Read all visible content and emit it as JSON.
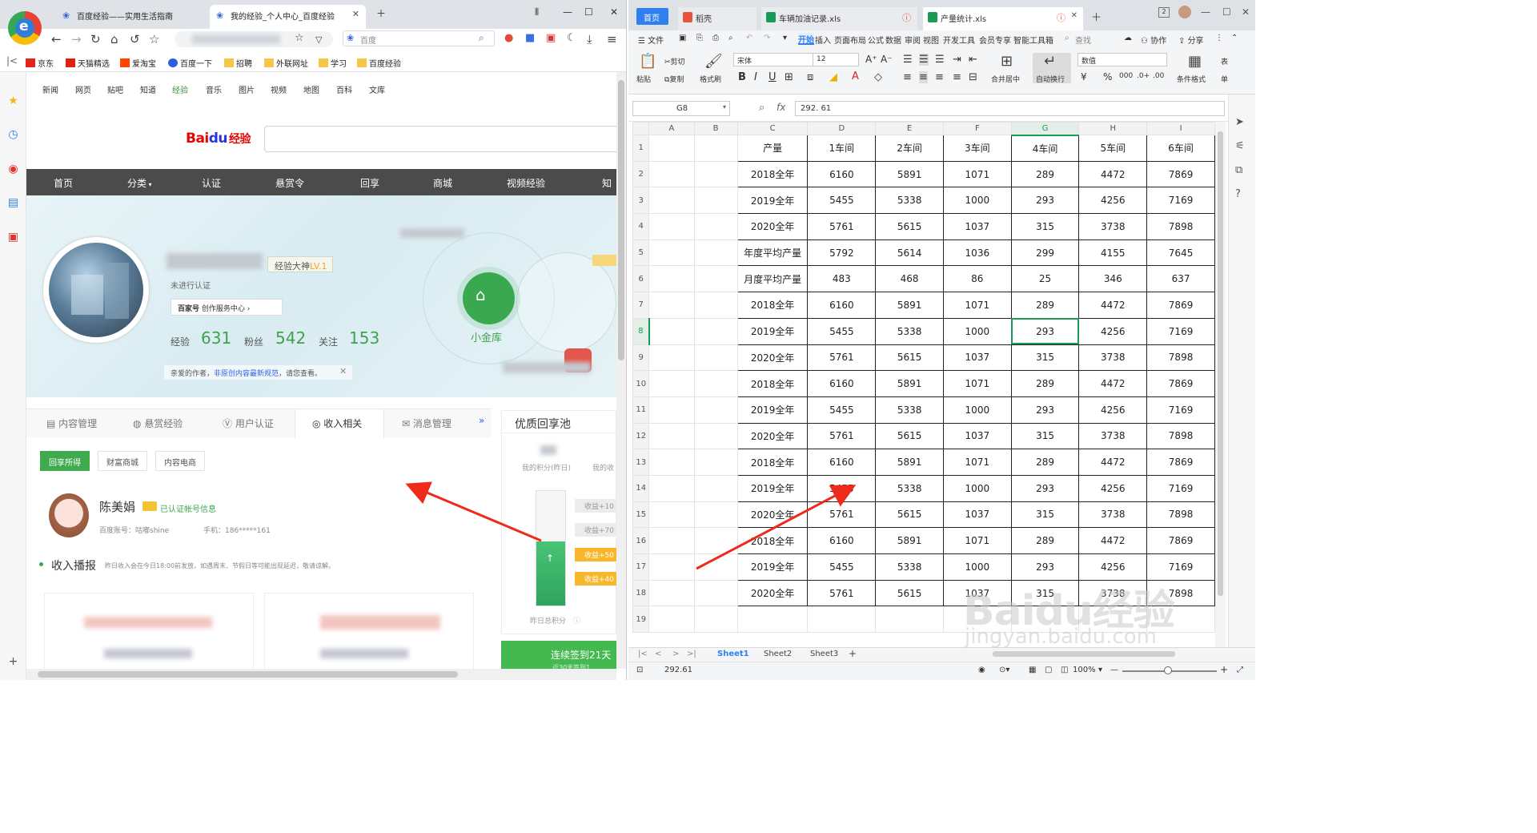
{
  "browser": {
    "tabs": [
      {
        "title": "百度经验——实用生活指南"
      },
      {
        "title": "我的经验_个人中心_百度经验"
      }
    ],
    "search_engine": "百度",
    "bookmarks": [
      "京东",
      "天猫精选",
      "爱淘宝",
      "百度一下",
      "招聘",
      "外联网址",
      "学习",
      "百度经验"
    ],
    "colors": {
      "accent_green": "#3fab4e",
      "menu_bg": "#4b4b4b"
    }
  },
  "page": {
    "top_nav": [
      "新闻",
      "网页",
      "贴吧",
      "知道",
      "经验",
      "音乐",
      "图片",
      "视频",
      "地图",
      "百科",
      "文库"
    ],
    "logo": {
      "bai": "Bai",
      "du": "du",
      "jy": "经验"
    },
    "main_menu": [
      "首页",
      "分类",
      "认证",
      "悬赏令",
      "回享",
      "商城",
      "视频经验",
      "知"
    ],
    "profile": {
      "level_label": "经验大神",
      "level": "LV.1",
      "cert_status": "未进行认证",
      "bjh_label": "百家号",
      "bjh_link": "创作服务中心",
      "stats": [
        {
          "label": "经验",
          "value": "631"
        },
        {
          "label": "粉丝",
          "value": "542"
        },
        {
          "label": "关注",
          "value": "153"
        }
      ],
      "notice_a": "亲爱的作者，",
      "notice_link": "非原创内容最新规范",
      "notice_b": "，请您查看。",
      "vault_label": "小金库"
    },
    "content_tabs": [
      "内容管理",
      "悬赏经验",
      "用户认证",
      "收入相关",
      "消息管理"
    ],
    "sub_tabs": [
      "回享所得",
      "财富商城",
      "内容电商"
    ],
    "user": {
      "name": "陈美娟",
      "verified": "已认证帐号信息",
      "account": "百度账号：咕嘟shine",
      "phone": "手机：186*****161"
    },
    "income": {
      "title": "收入播报",
      "note": "昨日收入会在今日18:00前发放，如遇周末、节假日等可能出现延迟，敬请谅解。"
    },
    "pool": {
      "title": "优质回享池",
      "points_label": "我的积分(昨日)",
      "points_label2": "我的收",
      "tags": [
        "收益+10",
        "收益+70",
        "收益+50",
        "收益+40"
      ],
      "total_label": "昨日总积分"
    },
    "sign": {
      "label": "连续签到21天",
      "sub": "近30天签到1"
    }
  },
  "sheet": {
    "home_tab": "首页",
    "tabs": [
      {
        "title": "稻壳"
      },
      {
        "title": "车辆加油记录.xls"
      },
      {
        "title": "产量统计.xls"
      }
    ],
    "menu": [
      "文件",
      "开始",
      "插入",
      "页面布局",
      "公式",
      "数据",
      "审阅",
      "视图",
      "开发工具",
      "会员专享",
      "智能工具箱"
    ],
    "search_label": "查找",
    "collab": "协作",
    "share": "分享",
    "ribbon": {
      "paste": "粘贴",
      "cut": "剪切",
      "copy": "复制",
      "format_painter": "格式刷",
      "font": "宋体",
      "size": "12",
      "merge": "合并居中",
      "autowrap": "自动换行",
      "number_format": "数值",
      "cond_format": "条件格式",
      "table_style": "表",
      "cell_style": "单"
    },
    "name_box": "G8",
    "formula": "292. 61",
    "col_headers": [
      "A",
      "B",
      "C",
      "D",
      "E",
      "F",
      "G",
      "H",
      "I"
    ],
    "table": {
      "header": [
        "产量",
        "1车间",
        "2车间",
        "3车间",
        "4车间",
        "5车间",
        "6车间"
      ],
      "rows": [
        [
          "2018全年",
          "6160",
          "5891",
          "1071",
          "289",
          "4472",
          "7869"
        ],
        [
          "2019全年",
          "5455",
          "5338",
          "1000",
          "293",
          "4256",
          "7169"
        ],
        [
          "2020全年",
          "5761",
          "5615",
          "1037",
          "315",
          "3738",
          "7898"
        ],
        [
          "年度平均产量",
          "5792",
          "5614",
          "1036",
          "299",
          "4155",
          "7645"
        ],
        [
          "月度平均产量",
          "483",
          "468",
          "86",
          "25",
          "346",
          "637"
        ],
        [
          "2018全年",
          "6160",
          "5891",
          "1071",
          "289",
          "4472",
          "7869"
        ],
        [
          "2019全年",
          "5455",
          "5338",
          "1000",
          "293",
          "4256",
          "7169"
        ],
        [
          "2020全年",
          "5761",
          "5615",
          "1037",
          "315",
          "3738",
          "7898"
        ],
        [
          "2018全年",
          "6160",
          "5891",
          "1071",
          "289",
          "4472",
          "7869"
        ],
        [
          "2019全年",
          "5455",
          "5338",
          "1000",
          "293",
          "4256",
          "7169"
        ],
        [
          "2020全年",
          "5761",
          "5615",
          "1037",
          "315",
          "3738",
          "7898"
        ],
        [
          "2018全年",
          "6160",
          "5891",
          "1071",
          "289",
          "4472",
          "7869"
        ],
        [
          "2019全年",
          "5455",
          "5338",
          "1000",
          "293",
          "4256",
          "7169"
        ],
        [
          "2020全年",
          "5761",
          "5615",
          "1037",
          "315",
          "3738",
          "7898"
        ],
        [
          "2018全年",
          "6160",
          "5891",
          "1071",
          "289",
          "4472",
          "7869"
        ],
        [
          "2019全年",
          "5455",
          "5338",
          "1000",
          "293",
          "4256",
          "7169"
        ],
        [
          "2020全年",
          "5761",
          "5615",
          "1037",
          "315",
          "3738",
          "7898"
        ]
      ]
    },
    "sheet_tabs": [
      "Sheet1",
      "Sheet2",
      "Sheet3"
    ],
    "status": {
      "value": "292.61",
      "zoom": "100%"
    },
    "watermark": {
      "main": "Baidu经验",
      "sub": "jingyan.baidu.com"
    },
    "colors": {
      "selection": "#1a9b55",
      "accent": "#2f7ff0"
    }
  }
}
